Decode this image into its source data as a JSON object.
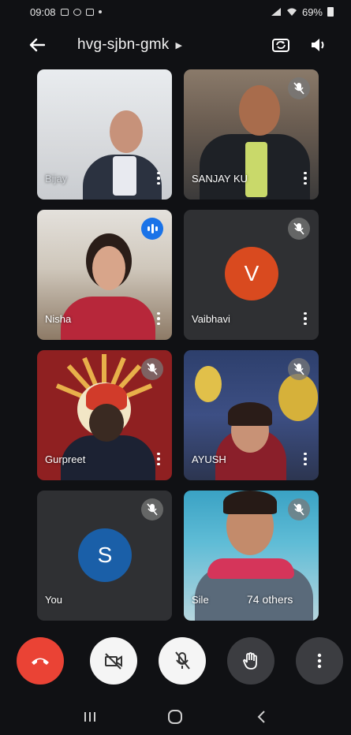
{
  "status_bar": {
    "time": "09:08",
    "right_text": "69%",
    "icons": [
      "gallery-icon",
      "whatsapp-icon",
      "message-icon",
      "dot-icon",
      "signal-icon",
      "wifi-icon",
      "battery-icon"
    ]
  },
  "header": {
    "meeting_code": "hvg-sjbn-gmk",
    "icons": [
      "back-arrow-icon",
      "caret-right-icon",
      "switch-camera-icon",
      "speaker-icon"
    ]
  },
  "participants": [
    {
      "name": "Bijay",
      "muted": false,
      "speaking": false,
      "has_video": true
    },
    {
      "name": "SANJAY KU",
      "muted": true,
      "speaking": false,
      "has_video": true
    },
    {
      "name": "Nisha",
      "muted": false,
      "speaking": true,
      "has_video": true
    },
    {
      "name": "Vaibhavi",
      "muted": true,
      "speaking": false,
      "has_video": false,
      "initial": "V",
      "avatar_color": "#d94a1f"
    },
    {
      "name": "Gurpreet",
      "muted": true,
      "speaking": false,
      "has_video": true
    },
    {
      "name": "AYUSH",
      "muted": true,
      "speaking": false,
      "has_video": true
    },
    {
      "name": "You",
      "muted": true,
      "speaking": false,
      "has_video": false,
      "initial": "S",
      "avatar_color": "#1a5fa8"
    },
    {
      "name": "Sile",
      "muted": true,
      "speaking": false,
      "has_video": true,
      "others_label": "74 others"
    }
  ],
  "controls": {
    "items": [
      "end-call-icon",
      "camera-off-icon",
      "mic-off-icon",
      "raise-hand-icon",
      "more-options-icon"
    ],
    "end_call_color": "#ea4335"
  },
  "navbar": {
    "recents": "III",
    "home": "O",
    "back": "<"
  }
}
